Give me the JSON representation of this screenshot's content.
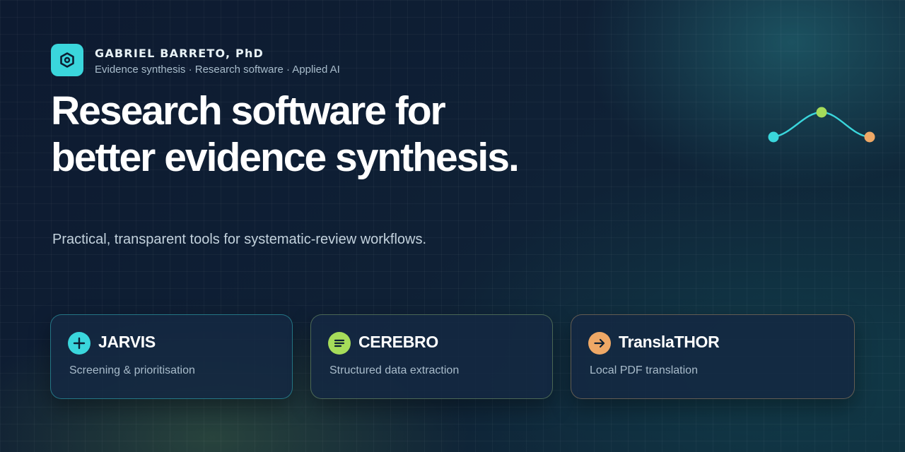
{
  "brand": {
    "name": "GABRIEL BARRETO, PhD",
    "tagline": "Evidence synthesis · Research software · Applied AI",
    "logo_icon": "hexagon-icon",
    "accent_color": "#3ad6dc"
  },
  "hero": {
    "headline_line1": "Research software for",
    "headline_line2": "better evidence synthesis.",
    "subtitle": "Practical, transparent tools for systematic-review workflows."
  },
  "decoration": {
    "icon": "wave-nodes-icon",
    "colors": [
      "#3ad6dc",
      "#a6dc5a",
      "#eea866"
    ]
  },
  "tools": [
    {
      "name": "JARVIS",
      "description": "Screening & prioritisation",
      "icon": "plus-icon",
      "color": "#3ad6dc"
    },
    {
      "name": "CEREBRO",
      "description": "Structured data extraction",
      "icon": "lines-icon",
      "color": "#a6dc5a"
    },
    {
      "name": "TranslaTHOR",
      "description": "Local PDF translation",
      "icon": "arrow-right-icon",
      "color": "#eea866"
    }
  ]
}
